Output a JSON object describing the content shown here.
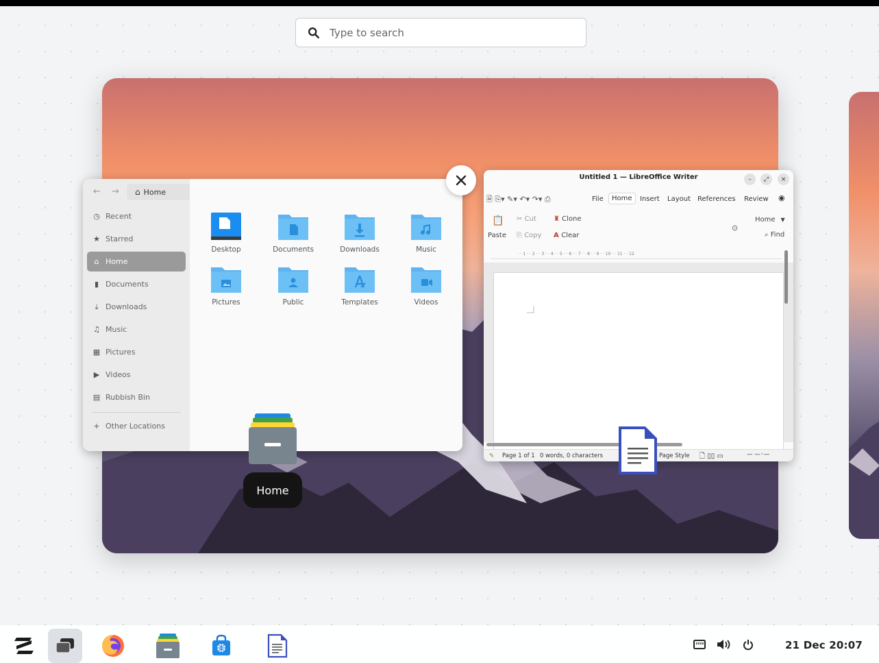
{
  "search": {
    "placeholder": "Type to search"
  },
  "files_window": {
    "path": "Home",
    "sidebar": [
      {
        "label": "Recent",
        "icon": "clock-icon"
      },
      {
        "label": "Starred",
        "icon": "star-icon"
      },
      {
        "label": "Home",
        "icon": "home-icon",
        "active": true
      },
      {
        "label": "Documents",
        "icon": "document-icon"
      },
      {
        "label": "Downloads",
        "icon": "download-icon"
      },
      {
        "label": "Music",
        "icon": "music-icon"
      },
      {
        "label": "Pictures",
        "icon": "picture-icon"
      },
      {
        "label": "Videos",
        "icon": "video-icon"
      },
      {
        "label": "Rubbish Bin",
        "icon": "trash-icon"
      },
      {
        "label": "Other Locations",
        "icon": "plus-icon"
      }
    ],
    "folders": [
      {
        "label": "Desktop"
      },
      {
        "label": "Documents"
      },
      {
        "label": "Downloads"
      },
      {
        "label": "Music"
      },
      {
        "label": "Pictures"
      },
      {
        "label": "Public"
      },
      {
        "label": "Templates"
      },
      {
        "label": "Videos"
      }
    ]
  },
  "tooltip": {
    "label": "Home"
  },
  "writer_window": {
    "title": "Untitled 1 — LibreOffice Writer",
    "tabs": [
      "File",
      "Home",
      "Insert",
      "Layout",
      "References",
      "Review"
    ],
    "active_tab": "Home",
    "ribbon": {
      "paste": "Paste",
      "cut": "Cut",
      "copy": "Copy",
      "clone": "Clone",
      "clear": "Clear",
      "style": "Home",
      "find": "Find"
    },
    "status": {
      "page": "Page 1 of 1",
      "words": "0 words, 0 characters",
      "page_style": "Page Style"
    }
  },
  "taskbar": {
    "apps": [
      {
        "name": "zorin-menu-icon"
      },
      {
        "name": "workspaces-icon",
        "active": true
      },
      {
        "name": "firefox-icon"
      },
      {
        "name": "files-icon"
      },
      {
        "name": "software-store-icon"
      },
      {
        "name": "writer-icon"
      }
    ],
    "tray": [
      "network-icon",
      "volume-icon",
      "power-icon"
    ],
    "clock": "21 Dec  20:07"
  },
  "colors": {
    "folder_blue": "#5fb3ef",
    "folder_blue_dark": "#2a8fda",
    "desktop_blue": "#1c8df0",
    "writer_blue": "#3a4fbf"
  }
}
